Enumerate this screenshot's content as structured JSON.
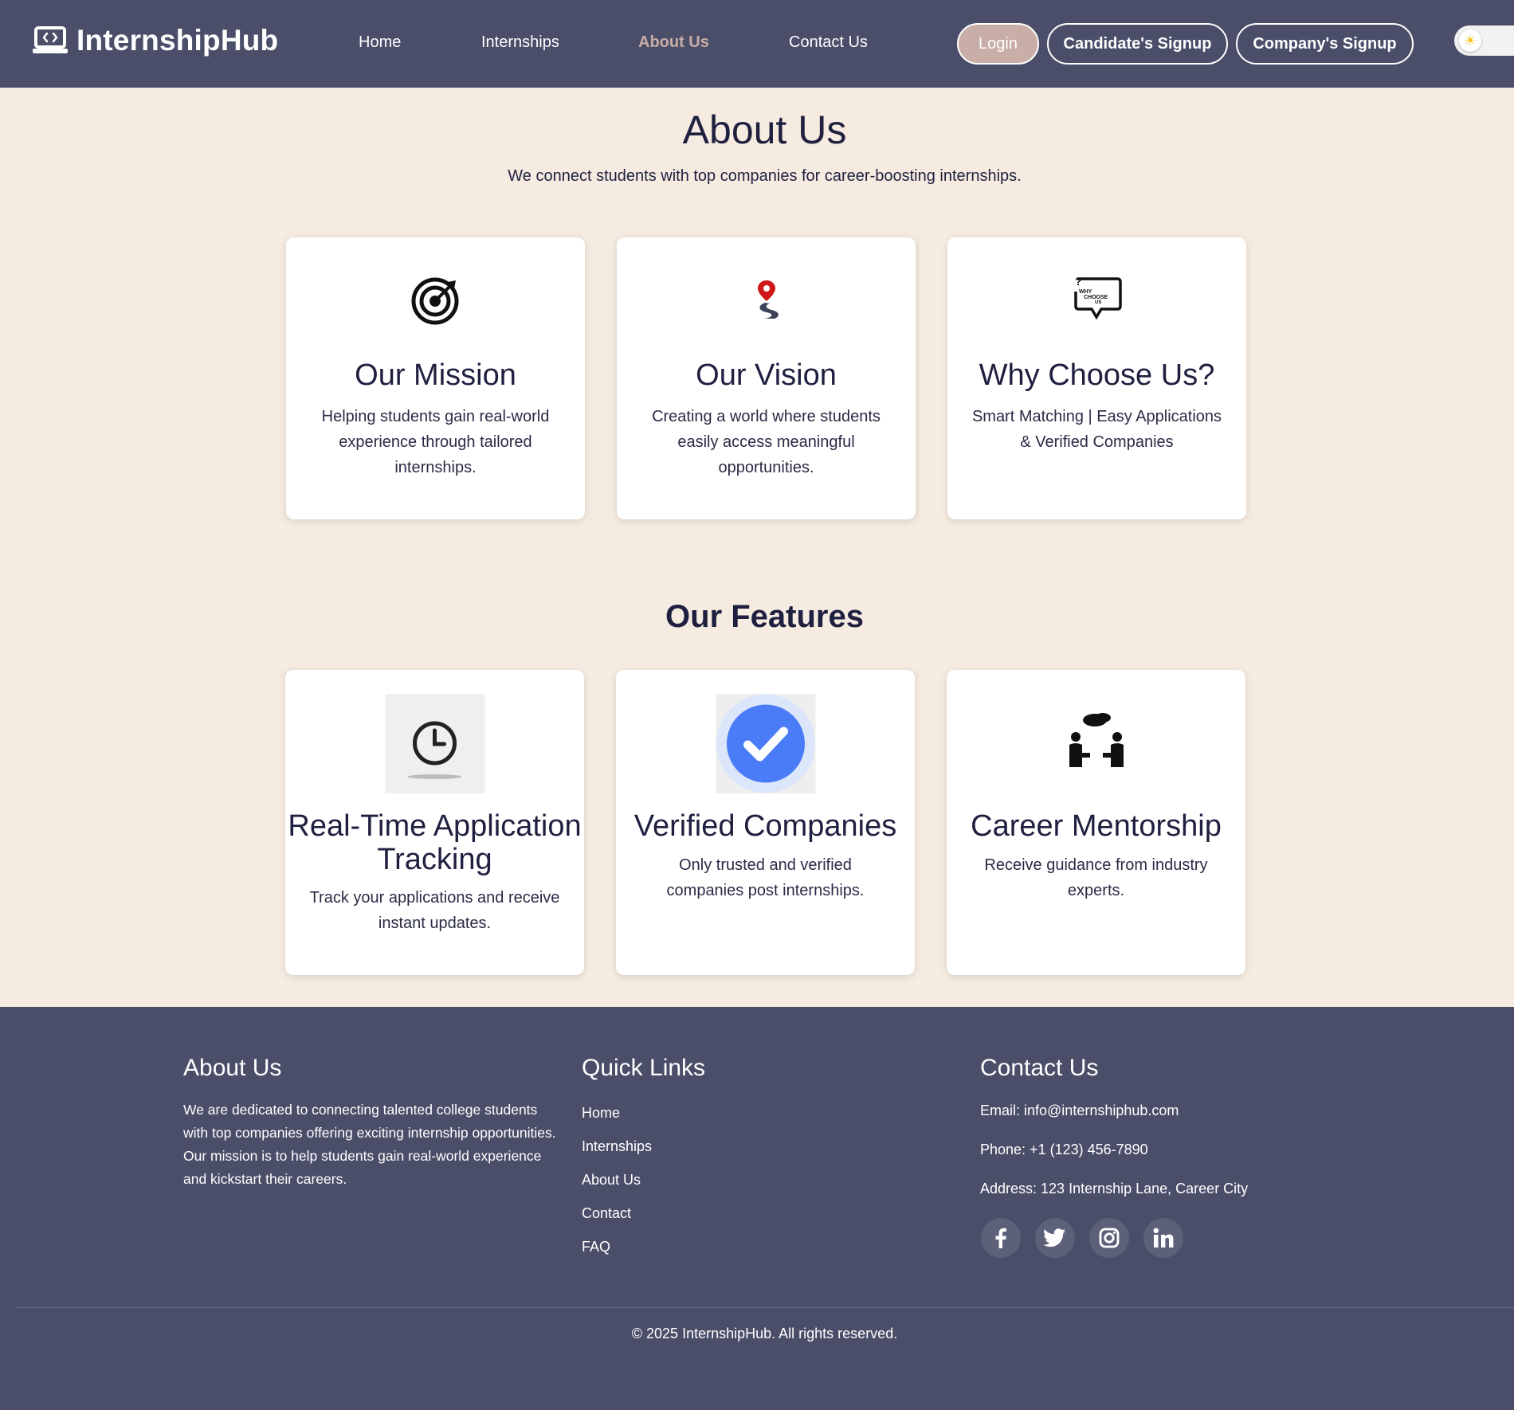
{
  "brand": {
    "name": "InternshipHub"
  },
  "nav": {
    "links": [
      "Home",
      "Internships",
      "About Us",
      "Contact Us"
    ],
    "active": "About Us",
    "login": "Login",
    "candidate_signup": "Candidate's Signup",
    "company_signup": "Company's Signup",
    "theme_icon": "sun-icon"
  },
  "hero": {
    "title": "About Us",
    "subtitle": "We connect students with top companies for career-boosting internships."
  },
  "info_cards": [
    {
      "icon": "target-icon",
      "title": "Our Mission",
      "text": "Helping students gain real-world experience through tailored internships."
    },
    {
      "icon": "map-pin-road-icon",
      "title": "Our Vision",
      "text": "Creating a world where students easily access meaningful opportunities."
    },
    {
      "icon": "why-choose-us-icon",
      "title": "Why Choose Us?",
      "text": "Smart Matching | Easy Applications & Verified Companies"
    }
  ],
  "features": {
    "title": "Our Features",
    "items": [
      {
        "icon": "clock-icon",
        "title": "Real-Time Application Tracking",
        "text": "Track your applications and receive instant updates."
      },
      {
        "icon": "verified-check-icon",
        "title": "Verified Companies",
        "text": "Only trusted and verified companies post internships."
      },
      {
        "icon": "mentorship-icon",
        "title": "Career Mentorship",
        "text": "Receive guidance from industry experts."
      }
    ]
  },
  "footer": {
    "about": {
      "heading": "About Us",
      "text": "We are dedicated to connecting talented college students with top companies offering exciting internship opportunities. Our mission is to help students gain real-world experience and kickstart their careers."
    },
    "quick_links": {
      "heading": "Quick Links",
      "items": [
        "Home",
        "Internships",
        "About Us",
        "Contact",
        "FAQ"
      ]
    },
    "contact": {
      "heading": "Contact Us",
      "email": "Email: info@internshiphub.com",
      "phone": "Phone: +1 (123) 456-7890",
      "address": "Address: 123 Internship Lane, Career City",
      "social": [
        "facebook-icon",
        "twitter-icon",
        "instagram-icon",
        "linkedin-icon"
      ]
    },
    "copyright": "© 2025 InternshipHub. All rights reserved."
  },
  "colors": {
    "nav_bg": "#4a4e69",
    "page_bg": "#f5ebe0",
    "accent": "#c9ada7",
    "text_dark": "#1f2040",
    "verified_blue": "#4a7cf7"
  }
}
